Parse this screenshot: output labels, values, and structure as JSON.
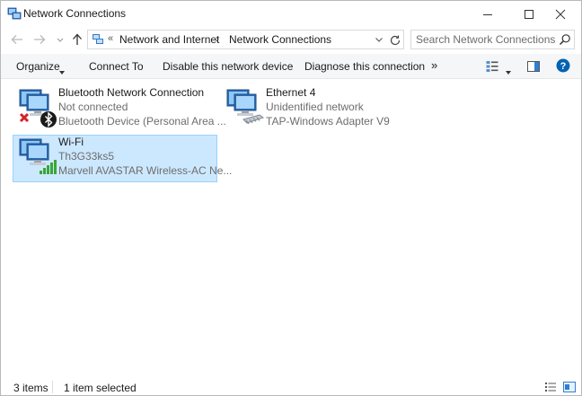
{
  "window": {
    "title": "Network Connections"
  },
  "address": {
    "overflow": "«",
    "crumbs": [
      "Network and Internet",
      "Network Connections"
    ],
    "separator": "›"
  },
  "search": {
    "placeholder": "Search Network Connections"
  },
  "commands": {
    "organize": "Organize",
    "connect_to": "Connect To",
    "disable": "Disable this network device",
    "diagnose": "Diagnose this connection",
    "more": "»"
  },
  "connections": [
    {
      "name": "Bluetooth Network Connection",
      "status": "Not connected",
      "device": "Bluetooth Device (Personal Area ...",
      "icon": "bluetooth-network-icon"
    },
    {
      "name": "Ethernet 4",
      "status": "Unidentified network",
      "device": "TAP-Windows Adapter V9",
      "icon": "ethernet-network-icon"
    },
    {
      "name": "Wi-Fi",
      "status": "Th3G33ks5",
      "device": "Marvell AVASTAR Wireless-AC Ne...",
      "icon": "wifi-network-icon",
      "selected": true
    }
  ],
  "status": {
    "item_count": "3 items",
    "selected": "1 item selected"
  },
  "colors": {
    "selection_bg": "#cce8ff",
    "selection_border": "#99d1ff",
    "help_blue": "#0063b1",
    "secondary_text": "#6d6d6d"
  }
}
